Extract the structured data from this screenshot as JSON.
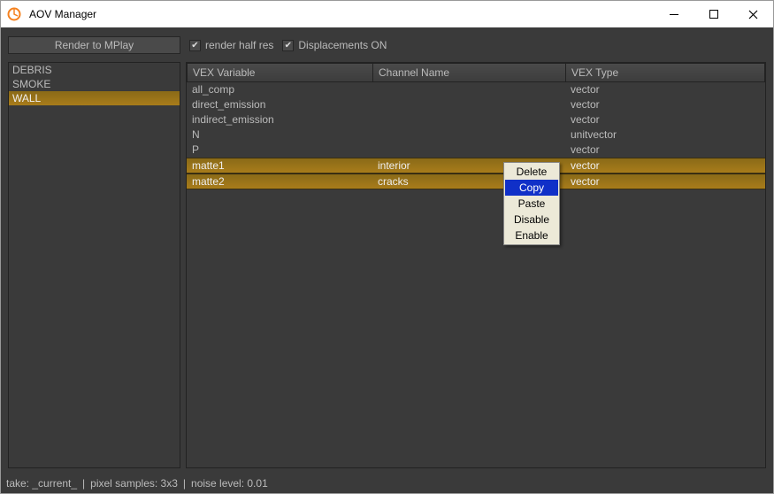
{
  "title": "AOV Manager",
  "toolbar": {
    "render_button": "Render to MPlay",
    "checkbox1": "render half res",
    "checkbox2": "Displacements ON"
  },
  "layers": [
    "DEBRIS",
    "SMOKE",
    "WALL"
  ],
  "layer_selected_index": 2,
  "columns": {
    "vex_variable": "VEX Variable",
    "channel_name": "Channel Name",
    "vex_type": "VEX Type"
  },
  "rows": [
    {
      "var": "all_comp",
      "chan": "",
      "type": "vector",
      "hl": false
    },
    {
      "var": "direct_emission",
      "chan": "",
      "type": "vector",
      "hl": false
    },
    {
      "var": "indirect_emission",
      "chan": "",
      "type": "vector",
      "hl": false
    },
    {
      "var": "N",
      "chan": "",
      "type": "unitvector",
      "hl": false
    },
    {
      "var": "P",
      "chan": "",
      "type": "vector",
      "hl": false
    },
    {
      "var": "matte1",
      "chan": "interior",
      "type": "vector",
      "hl": true
    },
    {
      "var": "matte2",
      "chan": "cracks",
      "type": "vector",
      "hl": true
    }
  ],
  "context_menu": {
    "items": [
      "Delete",
      "Copy",
      "Paste",
      "Disable",
      "Enable"
    ],
    "highlighted_index": 1
  },
  "status": {
    "take": "take: _current_",
    "samples": "pixel samples: 3x3",
    "noise": "noise level: 0.01"
  }
}
